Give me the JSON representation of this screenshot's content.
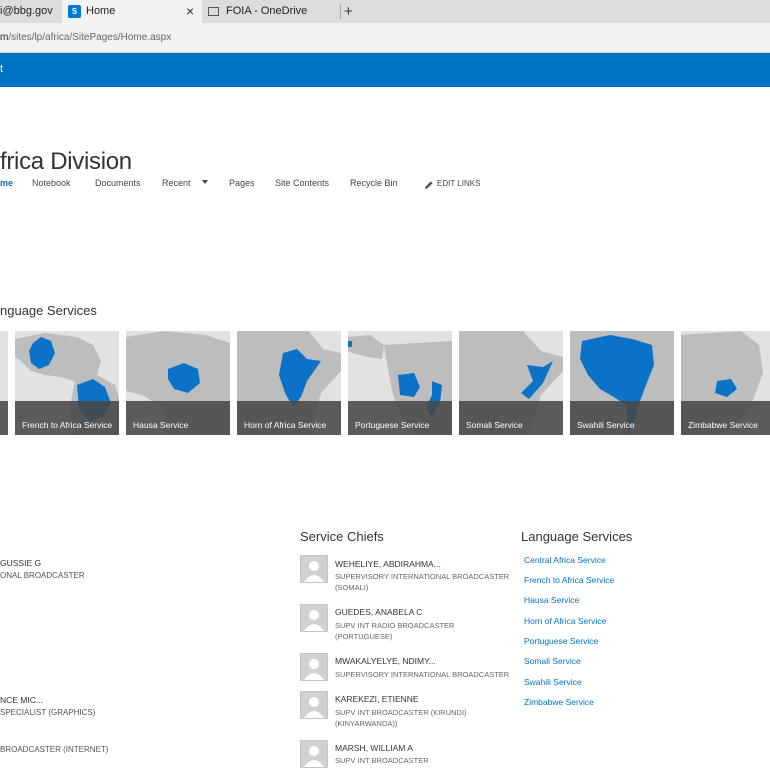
{
  "browser": {
    "tabs": [
      {
        "label": "i@bbg.gov"
      },
      {
        "label": "Home"
      },
      {
        "label": "FOIA - OneDrive"
      }
    ],
    "new_tab_glyph": "+",
    "close_glyph": "×",
    "address_host": "m",
    "address_path": "/sites/lp/africa/SitePages/Home.aspx"
  },
  "suite_bar": {
    "label": "t"
  },
  "site": {
    "title": "frica Division",
    "nav": {
      "home": "me",
      "notebook": "Notebook",
      "documents": "Documents",
      "recent": "Recent",
      "pages": "Pages",
      "site_contents": "Site Contents",
      "recycle_bin": "Recycle Bin",
      "edit_links": "EDIT LINKS"
    }
  },
  "tiles_section": {
    "heading": "nguage Services",
    "tiles": [
      {
        "label": "French to Africa Service"
      },
      {
        "label": "Hausa Service"
      },
      {
        "label": "Horn of Africa Service"
      },
      {
        "label": "Portuguese Service"
      },
      {
        "label": "Somali Service"
      },
      {
        "label": "Swahili Service"
      },
      {
        "label": "Zimbabwe Service"
      }
    ]
  },
  "left_people": [
    {
      "name": "GUSSIE G",
      "title": "ONAL BROADCASTER"
    },
    {
      "name": "NCE MIC...",
      "title": "SPECIALIST (GRAPHICS)"
    },
    {
      "name": "",
      "title": "BROADCASTER (INTERNET)"
    }
  ],
  "service_chiefs": {
    "heading": "Service Chiefs",
    "people": [
      {
        "name": "WEHELIYE, ABDIRAHMA...",
        "title1": "SUPERVISORY INTERNATIONAL BROADCASTER",
        "title2": "(SOMALI)"
      },
      {
        "name": "GUEDES, ANABELA C",
        "title1": "SUPV INT RADIO BROADCASTER",
        "title2": "(PORTUGUESE)"
      },
      {
        "name": "MWAKALYELYE, NDIMY...",
        "title1": "SUPERVISORY INTERNATIONAL BROADCASTER",
        "title2": ""
      },
      {
        "name": "KAREKEZI, ETIENNE",
        "title1": "SUPV INT BROADCASTER (KIRUNDI)",
        "title2": "(KINYARWANDA))"
      },
      {
        "name": "MARSH, WILLIAM A",
        "title1": "SUPV INT BROADCASTER",
        "title2": ""
      }
    ]
  },
  "language_services": {
    "heading": "Language Services",
    "links": [
      "Central Africa Service",
      "French to Africa Service",
      "Hausa Service",
      "Horn of Africa Service",
      "Portuguese Service",
      "Somali Service",
      "Swahili Service",
      "Zimbabwe Service"
    ]
  },
  "colors": {
    "accent": "#0072c6",
    "map_land": "#bdbdbd",
    "map_sea": "#e2e2e2",
    "map_highlight": "#0a72c7"
  }
}
